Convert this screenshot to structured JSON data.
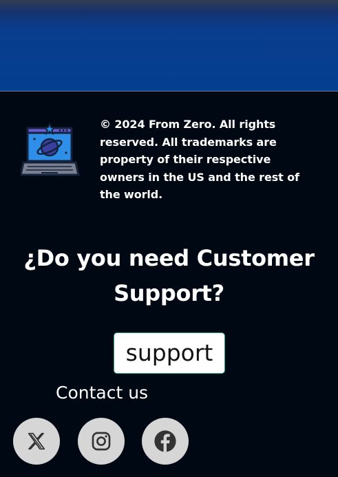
{
  "footer": {
    "copyright": "© 2024 From Zero. All rights reserved. All trademarks are property of their respective owners in the US and the rest of the world.",
    "support_heading": "¿Do you need Customer Support?",
    "support_button": "support",
    "contact_link": "Contact us",
    "social": [
      {
        "icon": "x-icon"
      },
      {
        "icon": "instagram-icon"
      },
      {
        "icon": "facebook-icon"
      }
    ],
    "logo_icon": "laptop-planet-icon"
  },
  "colors": {
    "hero_band": "#043e91",
    "footer_bg": "#000813",
    "social_bg": "#d6d6d6",
    "button_border": "#1fa08a",
    "logo_accent": "#2f8fe8"
  }
}
